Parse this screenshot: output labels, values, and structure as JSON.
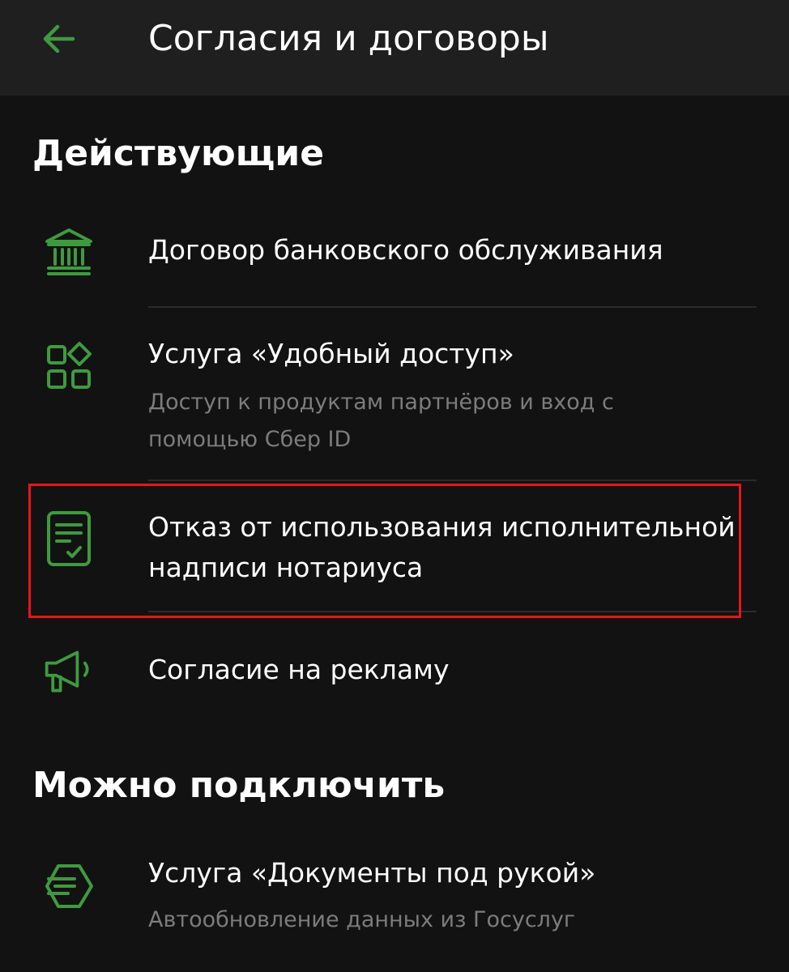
{
  "header": {
    "title": "Согласия и договоры"
  },
  "sections": {
    "active": {
      "title": "Действующие",
      "items": [
        {
          "title": "Договор банковского обслуживания",
          "icon": "bank-icon"
        },
        {
          "title": "Услуга «Удобный доступ»",
          "subtitle": "Доступ к продуктам партнёров и вход с помощью Сбер ID",
          "icon": "apps-icon"
        },
        {
          "title": "Отказ от использования исполнительной надписи нотариуса",
          "icon": "document-check-icon"
        },
        {
          "title": "Согласие на рекламу",
          "icon": "megaphone-icon"
        }
      ]
    },
    "available": {
      "title": "Можно подключить",
      "items": [
        {
          "title": "Услуга «Документы под рукой»",
          "subtitle": "Автообновление данных из Госуслуг",
          "icon": "documents-hexagon-icon"
        }
      ]
    }
  },
  "colors": {
    "background": "#121212",
    "header_background": "#1f1f1f",
    "accent_green": "#3f9a3f",
    "subtitle_gray": "#7c7c7c",
    "highlight_red": "#e8151b"
  }
}
